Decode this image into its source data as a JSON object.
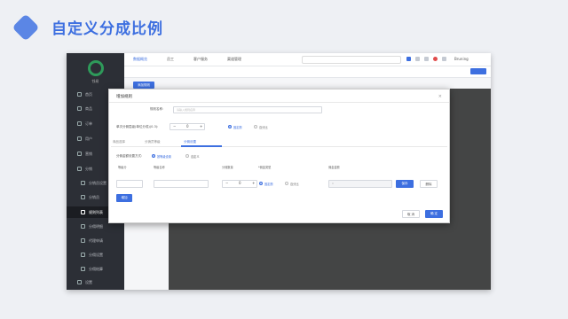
{
  "slide": {
    "title": "自定义分成比例"
  },
  "app": {
    "logo_text": "钱易",
    "user": "Bruning"
  },
  "sidebar": {
    "items": [
      {
        "label": "首页"
      },
      {
        "label": "商品"
      },
      {
        "label": "订单"
      },
      {
        "label": "用户"
      },
      {
        "label": "营销"
      },
      {
        "label": "分销"
      },
      {
        "label": "分销员设置"
      },
      {
        "label": "分销员"
      },
      {
        "label": "规则列表"
      },
      {
        "label": "分佣明细"
      },
      {
        "label": "代理申请"
      },
      {
        "label": "分佣设置"
      },
      {
        "label": "分佣结算"
      },
      {
        "label": "设置"
      }
    ]
  },
  "topnav": {
    "items": [
      {
        "label": "数据概览"
      },
      {
        "label": "员工"
      },
      {
        "label": "客户服务"
      },
      {
        "label": "渠道管理"
      }
    ]
  },
  "page": {
    "add_button": "添加规则"
  },
  "modal": {
    "title": "增加规则",
    "close": "×",
    "rule_name_label": "规则名称:",
    "rule_name_placeholder": "请输入规则名称",
    "level_label": "单次分佣层级(单位分成)(0-3):",
    "level_value": "0",
    "radio_fixed": "固定额",
    "radio_percent": "百分比",
    "tabs": [
      {
        "label": "商品选择"
      },
      {
        "label": "分销员等级"
      },
      {
        "label": "分佣设置"
      }
    ],
    "mode_label": "分佣金额设置方式:",
    "mode_auto": "按等级设置",
    "mode_custom": "自定义",
    "col_level": "等级分",
    "col_grade": "等级名称",
    "col_count": "分佣数量",
    "col_type": "*佣金类型",
    "col_amount": "佣金金额",
    "row_count_value": "0",
    "row_fixed": "固定额",
    "row_percent": "百分比",
    "row_amount_placeholder": "0",
    "save_btn": "保存",
    "delete_btn": "删除",
    "add_row_btn": "增加",
    "cancel_btn": "取 消",
    "confirm_btn": "确 定"
  }
}
